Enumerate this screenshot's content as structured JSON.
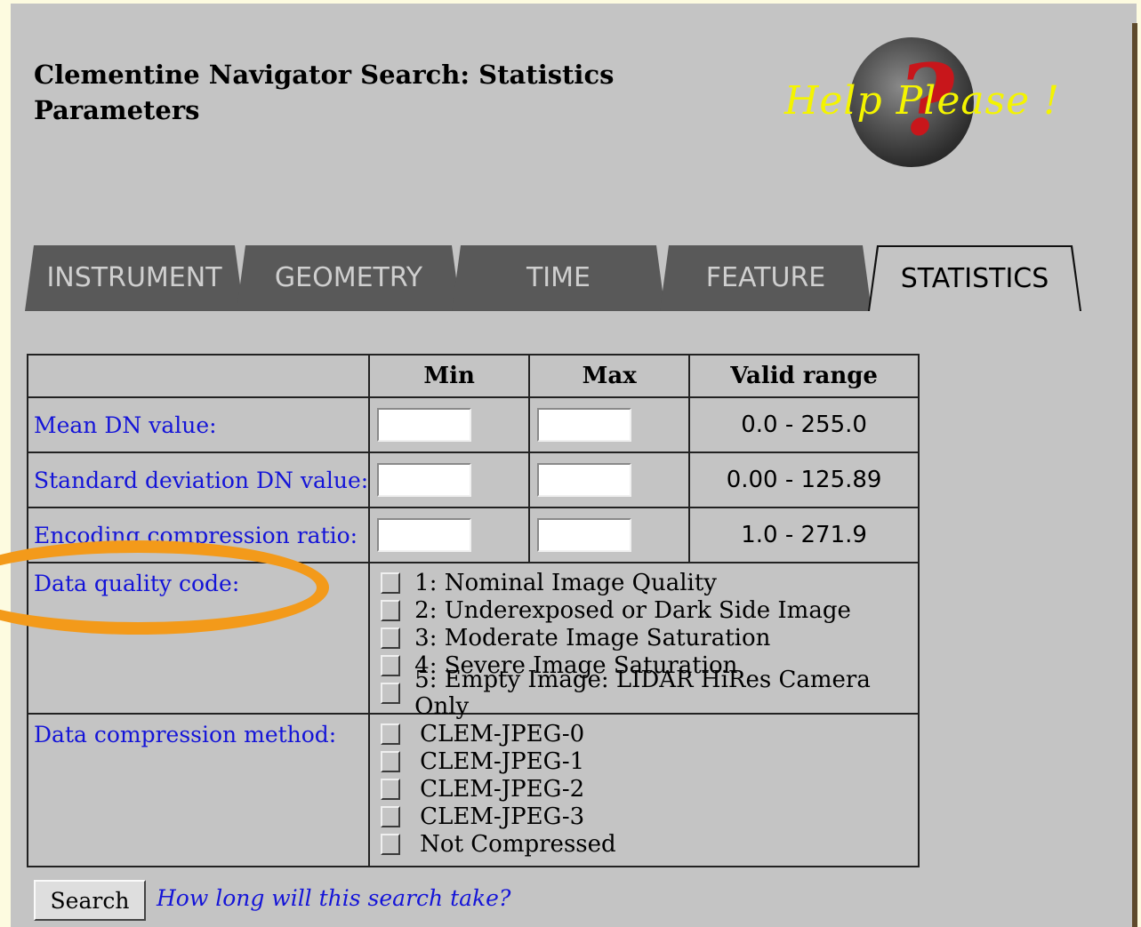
{
  "page": {
    "title": "Clementine Navigator Search: Statistics Parameters",
    "help_logo_text": "Help Please !",
    "colors": {
      "panel": "#c4c4c4",
      "link": "#1414d8",
      "annotation": "#f39a1a",
      "help_text": "#f4f400"
    }
  },
  "tabs": [
    {
      "label": "INSTRUMENT",
      "active": false
    },
    {
      "label": "GEOMETRY",
      "active": false
    },
    {
      "label": "TIME",
      "active": false
    },
    {
      "label": "FEATURE",
      "active": false
    },
    {
      "label": "STATISTICS",
      "active": true
    }
  ],
  "table": {
    "headers": {
      "min": "Min",
      "max": "Max",
      "valid": "Valid range"
    },
    "rows": [
      {
        "label": "Mean DN value:",
        "min": "",
        "max": "",
        "valid": "0.0 - 255.0"
      },
      {
        "label": "Standard deviation DN value:",
        "min": "",
        "max": "",
        "valid": "0.00 - 125.89"
      },
      {
        "label": "Encoding compression ratio:",
        "min": "",
        "max": "",
        "valid": "1.0 - 271.9"
      }
    ],
    "quality": {
      "label": "Data quality code:",
      "options": [
        "1: Nominal Image Quality",
        "2: Underexposed or Dark Side Image",
        "3: Moderate Image Saturation",
        "4: Severe Image Saturation",
        "5: Empty Image: LIDAR HiRes Camera Only"
      ]
    },
    "compression": {
      "label": "Data compression method:",
      "options": [
        "CLEM-JPEG-0",
        "CLEM-JPEG-1",
        "CLEM-JPEG-2",
        "CLEM-JPEG-3",
        "Not Compressed"
      ]
    }
  },
  "search": {
    "button": "Search",
    "howlong": "How long will this search take?"
  }
}
